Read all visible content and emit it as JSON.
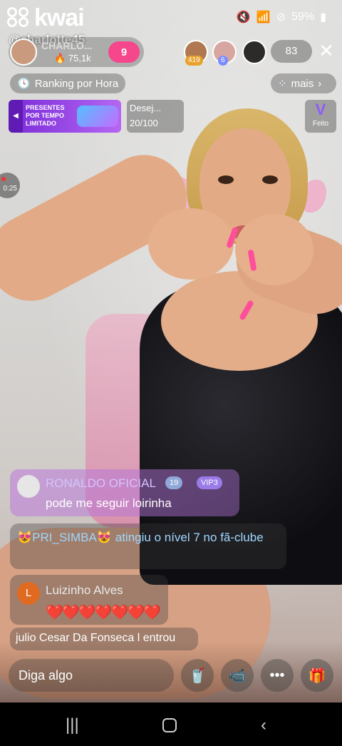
{
  "status_bar": {
    "brand": "kwai",
    "battery": "59%",
    "icons": [
      "mute-icon",
      "wifi-icon",
      "dnd-icon",
      "battery-icon"
    ]
  },
  "watermark_handle": "@charlotte45",
  "host": {
    "name": "CHARLO...",
    "likes": "75,1k",
    "follow_badge": "9"
  },
  "viewers": {
    "badges": [
      "419",
      "6"
    ],
    "count": "83"
  },
  "ranking": {
    "label": "Ranking por Hora"
  },
  "more": {
    "label": "mais"
  },
  "promo": {
    "text": "PRESENTES POR TEMPO LIMITADO"
  },
  "wish": {
    "title": "Desej...",
    "count": "20/100"
  },
  "feito": {
    "label": "Feito"
  },
  "rec": {
    "time": "0:25"
  },
  "chat": {
    "vip": {
      "name": "RONALDO OFICIAL",
      "level": "19",
      "vip": "VIP3",
      "message": "pode me seguir loirinha"
    },
    "level_up": {
      "text": "😻PRI_SIMBA😻 atingiu o nível 7 no fã-clube"
    },
    "luiz": {
      "initial": "L",
      "name": "Luizinho Alves",
      "message": "❤️❤️❤️❤️❤️❤️❤️"
    },
    "join": {
      "text": "julio Cesar Da Fonseca l entrou"
    }
  },
  "bottom": {
    "input_placeholder": "Diga algo"
  },
  "colors": {
    "accent_pink": "#f6468c",
    "promo_purple": "#7a2bd9",
    "chat_name": "#d5c3ff",
    "level_text": "#9fd6ff"
  }
}
